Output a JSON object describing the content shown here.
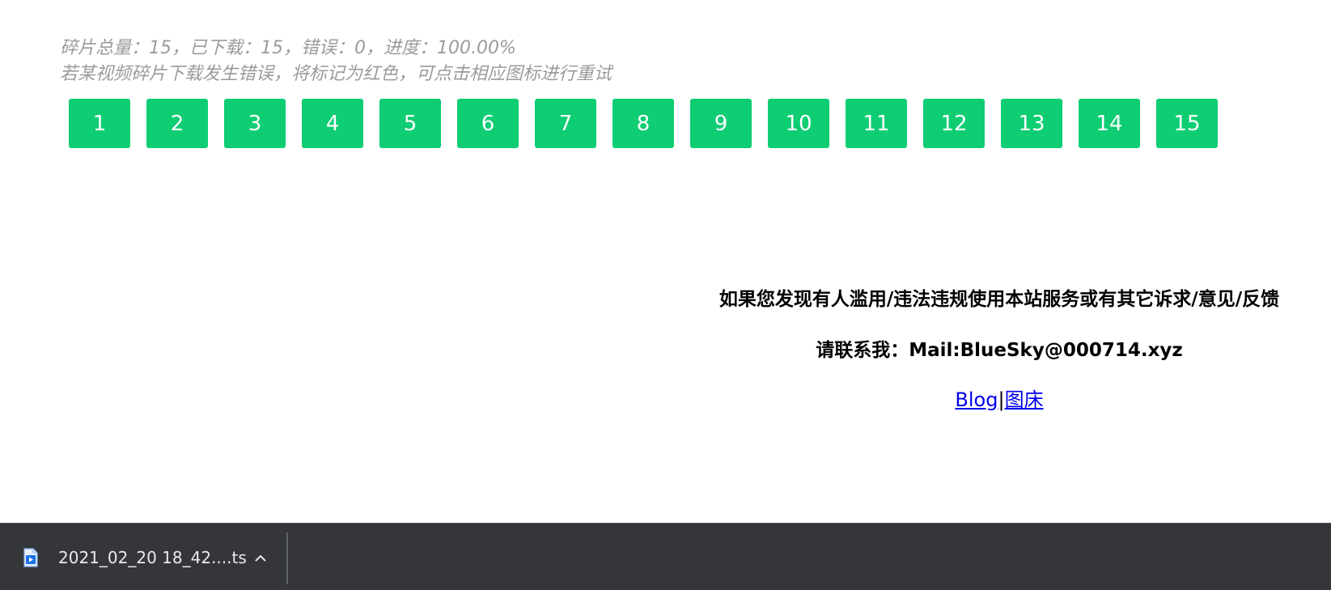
{
  "progress_info": {
    "line1": "碎片总量：15，已下载：15，错误：0，进度：100.00%",
    "line2": "若某视频碎片下载发生错误，将标记为红色，可点击相应图标进行重试"
  },
  "segments": [
    "1",
    "2",
    "3",
    "4",
    "5",
    "6",
    "7",
    "8",
    "9",
    "10",
    "11",
    "12",
    "13",
    "14",
    "15"
  ],
  "footer": {
    "report": "如果您发现有人滥用/违法违规使用本站服务或有其它诉求/意见/反馈",
    "contact": "请联系我：Mail:BlueSky@000714.xyz",
    "blog_link": "Blog",
    "separator": "|",
    "image_host_link": "图床"
  },
  "download_bar": {
    "filename": "2021_02_20 18_42....ts"
  },
  "colors": {
    "segment_done": "#0ecd73",
    "info_text": "#9b9b9b",
    "download_bar_bg": "#35363a"
  }
}
